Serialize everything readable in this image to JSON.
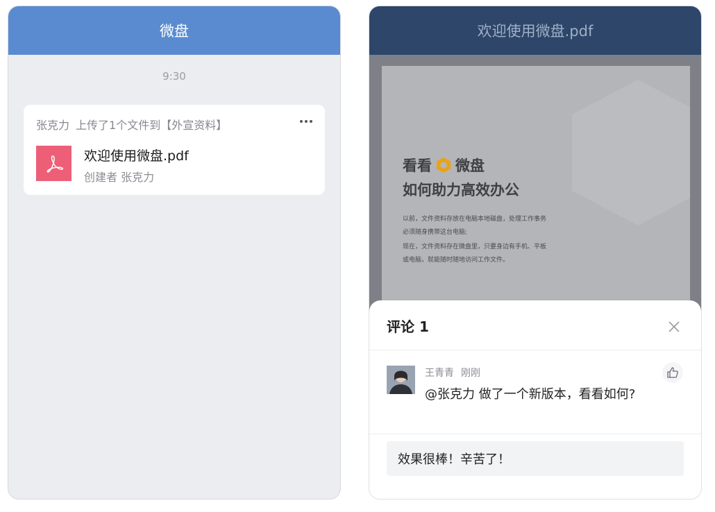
{
  "left": {
    "header_title": "微盘",
    "time": "9:30",
    "card": {
      "uploader": "张克力",
      "action": "上传了1个文件到【外宣资料】",
      "file_name": "欢迎使用微盘.pdf",
      "creator": "创建者 张克力",
      "file_icon": "pdf-icon",
      "file_icon_color": "#ec5f77"
    }
  },
  "right": {
    "header_title": "欢迎使用微盘.pdf",
    "doc": {
      "title_prefix": "看看",
      "brand": "微盘",
      "title_line2": "如何助力高效办公",
      "para1": "以前，文件资料存放在电脑本地磁盘，处理工作事务必须随身携带这台电脑;",
      "para2": "现在，文件资料存在微盘里，只要身边有手机、平板或电脑，就能随时随地访问工作文件。",
      "logo_color": "#e8a317"
    },
    "comments": {
      "title": "评论 1",
      "items": [
        {
          "author": "王青青",
          "time": "刚刚",
          "text": "@张克力 做了一个新版本，看看如何?"
        }
      ],
      "reply_value": "效果很棒！辛苦了！"
    }
  },
  "colors": {
    "left_header": "#5a8bd0",
    "right_header": "#2d4669"
  }
}
